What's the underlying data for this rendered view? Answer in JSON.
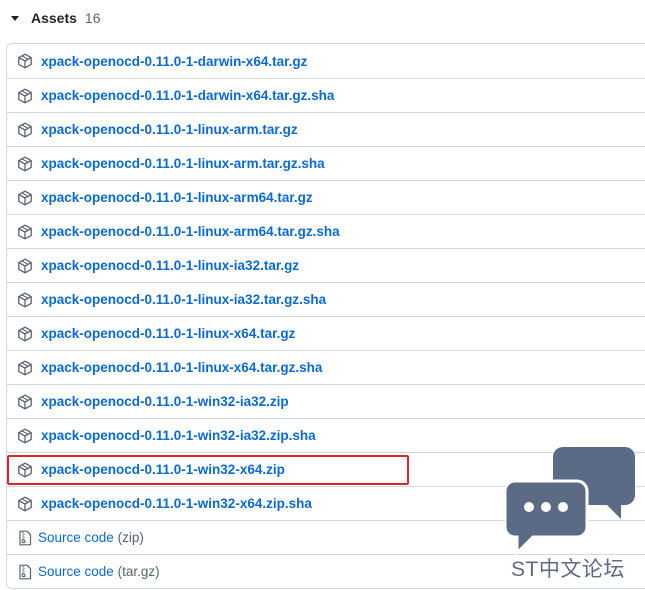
{
  "assets": {
    "title": "Assets",
    "count": "16",
    "files": [
      "xpack-openocd-0.11.0-1-darwin-x64.tar.gz",
      "xpack-openocd-0.11.0-1-darwin-x64.tar.gz.sha",
      "xpack-openocd-0.11.0-1-linux-arm.tar.gz",
      "xpack-openocd-0.11.0-1-linux-arm.tar.gz.sha",
      "xpack-openocd-0.11.0-1-linux-arm64.tar.gz",
      "xpack-openocd-0.11.0-1-linux-arm64.tar.gz.sha",
      "xpack-openocd-0.11.0-1-linux-ia32.tar.gz",
      "xpack-openocd-0.11.0-1-linux-ia32.tar.gz.sha",
      "xpack-openocd-0.11.0-1-linux-x64.tar.gz",
      "xpack-openocd-0.11.0-1-linux-x64.tar.gz.sha",
      "xpack-openocd-0.11.0-1-win32-ia32.zip",
      "xpack-openocd-0.11.0-1-win32-ia32.zip.sha",
      "xpack-openocd-0.11.0-1-win32-x64.zip",
      "xpack-openocd-0.11.0-1-win32-x64.zip.sha"
    ],
    "highlighted_index": 12,
    "source": [
      {
        "label": "Source code",
        "kind": "(zip)"
      },
      {
        "label": "Source code",
        "kind": "(tar.gz)"
      }
    ]
  },
  "icons": {
    "file": "package-icon",
    "source": "file-zip-icon",
    "toggle": "triangle-down-icon"
  },
  "colors": {
    "link": "#0969da",
    "highlight": "#e0242c",
    "watermark": "#5b6b85"
  },
  "watermark": {
    "text": "ST中文论坛"
  }
}
